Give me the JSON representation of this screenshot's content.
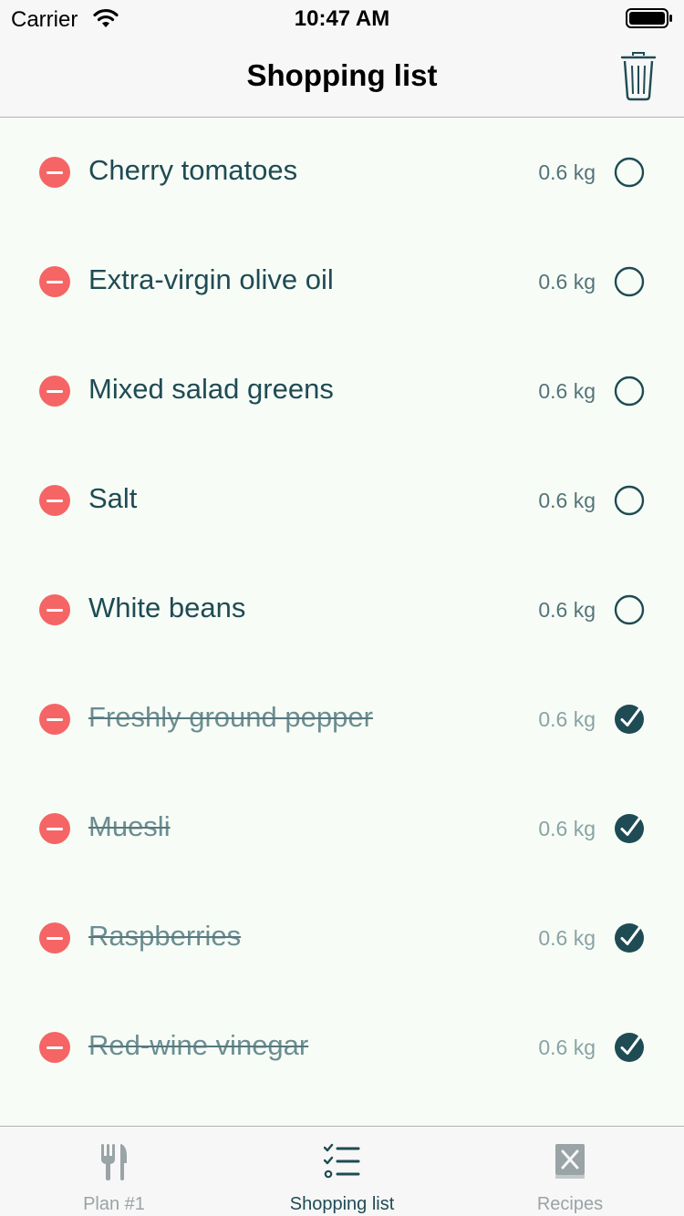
{
  "status_bar": {
    "carrier": "Carrier",
    "time": "10:47 AM"
  },
  "nav": {
    "title": "Shopping list",
    "trash_icon": "trash-icon"
  },
  "items": [
    {
      "name": "Cherry tomatoes",
      "quantity": "0.6 kg",
      "checked": false
    },
    {
      "name": "Extra-virgin olive oil",
      "quantity": "0.6 kg",
      "checked": false
    },
    {
      "name": "Mixed salad greens",
      "quantity": "0.6 kg",
      "checked": false
    },
    {
      "name": "Salt",
      "quantity": "0.6 kg",
      "checked": false
    },
    {
      "name": "White beans",
      "quantity": "0.6 kg",
      "checked": false
    },
    {
      "name": "Freshly ground pepper",
      "quantity": "0.6 kg",
      "checked": true
    },
    {
      "name": "Muesli",
      "quantity": "0.6 kg",
      "checked": true
    },
    {
      "name": "Raspberries",
      "quantity": "0.6 kg",
      "checked": true
    },
    {
      "name": "Red-wine vinegar",
      "quantity": "0.6 kg",
      "checked": true
    }
  ],
  "tabs": [
    {
      "label": "Plan #1",
      "icon": "fork-knife-icon",
      "active": false
    },
    {
      "label": "Shopping list",
      "icon": "checklist-icon",
      "active": true
    },
    {
      "label": "Recipes",
      "icon": "recipe-book-icon",
      "active": false
    }
  ],
  "colors": {
    "accent": "#1f4b54",
    "delete": "#f56565",
    "background": "#f7fdf6",
    "inactive_tab": "#9aa3a5"
  }
}
